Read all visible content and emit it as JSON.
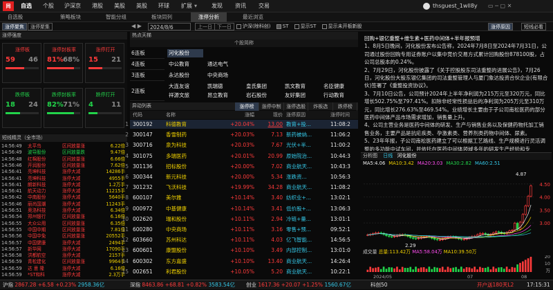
{
  "app": {
    "logo": "同花顺",
    "window_user": "thsguest_1wll8y",
    "time": "17:15:31"
  },
  "menu": [
    "自选",
    "个股",
    "沪深京",
    "港股",
    "美股",
    "英股",
    "环球",
    "扩展",
    "发现",
    "资讯",
    "交易"
  ],
  "menu_more": "▾",
  "sub_tabs": [
    "自选股",
    "策略板块",
    "智能分组",
    "板块同列",
    "涨停分析",
    "最近浏览"
  ],
  "toolbar": {
    "label_limit": "涨停聚焦",
    "label_top": "涨停聚集",
    "date": "2024/8/6",
    "prev": "上一日",
    "next": "下一日",
    "opt1": "沪深(除科创)",
    "opt2": "ST",
    "opt3": "显示ST",
    "opt4": "显示未开板新股",
    "btn_reason": "涨停原因",
    "btn_summary": "短线必看"
  },
  "left": {
    "header": "涨停强度",
    "stats": [
      {
        "title": "涨停板",
        "a": "59",
        "b": "46",
        "ratio": 0.56
      },
      {
        "title": "涨停封板率",
        "a": "81%",
        "b": "68%",
        "ratio": 0.81
      },
      {
        "title": "涨停打开",
        "a": "15",
        "b": "21",
        "ratio": 0.42
      },
      {
        "title": "跌停板",
        "a": "18",
        "b": "24",
        "ratio": 0.43
      },
      {
        "title": "跌停封板率",
        "a": "82%",
        "b": "71%",
        "ratio": 0.82
      },
      {
        "title": "跌停打开",
        "a": "4",
        "b": "11",
        "ratio": 0.27
      }
    ],
    "flow_header": "短线精灵（全市场）",
    "flow": [
      [
        "14:56:49",
        "太平鸟",
        "区间放量涨",
        "6.22倍"
      ],
      [
        "14:56:49",
        "波导股份",
        "区间放量跌",
        "9.47倍"
      ],
      [
        "14:56:48",
        "红棉股份",
        "区间放量涨",
        "6.66倍"
      ],
      [
        "14:56:46",
        "开润股份",
        "区间放量涨",
        "7.62倍"
      ],
      [
        "14:56:41",
        "亮坤科技",
        "涨停大减",
        "14286手"
      ],
      [
        "14:56:41",
        "亮坤科技",
        "涨停大减",
        "4955手"
      ],
      [
        "14:56:41",
        "朗新科技",
        "涨停大减",
        "1.2万手"
      ],
      [
        "14:56:41",
        "航天动力",
        "涨停大减",
        "11215手"
      ],
      [
        "14:56:42",
        "中南股份",
        "涨停大减",
        "5640手"
      ],
      [
        "14:56:46",
        "丽尚国潮",
        "涨停大减",
        "11243手"
      ],
      [
        "14:56:51",
        "奥洛科技",
        "涨停大减",
        "6.34倍"
      ],
      [
        "14:56:54",
        "郑州银行",
        "区间放量涨",
        "6.16倍"
      ],
      [
        "14:56:55",
        "大众公用",
        "区间放量涨",
        "6.35倍"
      ],
      [
        "14:56:55",
        "中国中期",
        "区间放量涨",
        "7.81倍"
      ],
      [
        "14:56:56",
        "中国中免",
        "区间放量涨",
        "20552手"
      ],
      [
        "14:56:57",
        "中国健康",
        "涨停大减",
        "2494手"
      ],
      [
        "14:56:57",
        "新华网",
        "涨停大减",
        "17090手"
      ],
      [
        "14:56:58",
        "洪都航空",
        "涨停大减",
        "2157手"
      ],
      [
        "14:56:59",
        "青松建化",
        "区间放量涨",
        "9964手"
      ],
      [
        "14:56:59",
        "达 意 隆",
        "涨停大减",
        "6.16倍"
      ],
      [
        "14:56:59",
        "*ST和科",
        "涨停大减",
        "2.3万手"
      ]
    ]
  },
  "heaven": {
    "header": "热点天梯",
    "col": "个股简称",
    "levels": [
      {
        "label": "6连板",
        "stocks": [
          "河化股份"
        ]
      },
      {
        "label": "4连板",
        "stocks": [
          "中公教育",
          "通达电气"
        ]
      },
      {
        "label": "3连板",
        "stocks": [
          "永达股份",
          "中央商场"
        ]
      },
      {
        "label": "2连板",
        "stocks": [
          "大连友谊",
          "凯瑞德",
          "皇氏集团",
          "凯文教育",
          "名臣健康",
          "祥源文旅",
          "昂立教育",
          "岩石股份",
          "友好集团",
          "行动教育"
        ]
      }
    ]
  },
  "list": {
    "header": "异动列表",
    "tabs": [
      "涨停榜",
      "涨停中制",
      "涨停选股",
      "炸板选",
      "跌停榜"
    ],
    "cols": [
      "代码",
      "名称",
      "涨幅",
      "现价",
      "涨停原因",
      "涨停时间"
    ],
    "rows": [
      [
        "300192",
        "科德教育",
        "+20.04%",
        "13.00",
        "教育+投...",
        "11:08:2"
      ],
      [
        "300147",
        "香雪制药",
        "+20.03%",
        "7.13",
        "新药被纳...",
        "11:06:2"
      ],
      [
        "300716",
        "泉为科技",
        "+20.03%",
        "7.67",
        "光伏+半...",
        "11:00:2"
      ],
      [
        "301075",
        "多瑞医药",
        "+20.01%",
        "20.99",
        "原始院治...",
        "10:44:3"
      ],
      [
        "301136",
        "招标股份",
        "+20.00%",
        "7.02",
        "商业航天...",
        "10:43:3"
      ],
      [
        "300344",
        "新元科技",
        "+20.00%",
        "5.34",
        "涨跌资...",
        "10:56:3"
      ],
      [
        "301232",
        "飞沃科技",
        "+19.99%",
        "34.28",
        "商业航天...",
        "11:08:2"
      ],
      [
        "600107",
        "美尔雅",
        "+10.14%",
        "3.40",
        "纺织业+...",
        "13:02:1"
      ],
      [
        "000972",
        "中基健康",
        "+10.14%",
        "3.41",
        "低价股+...",
        "13:06:3"
      ],
      [
        "002620",
        "瑞和股份",
        "+10.11%",
        "2.94",
        "冷链+量...",
        "13:01:1"
      ],
      [
        "600280",
        "中央商场",
        "+10.11%",
        "3.16",
        "零售+预...",
        "09:52:1"
      ],
      [
        "603660",
        "苏州科达",
        "+10.11%",
        "4.03",
        "亿飞智能...",
        "14:56:5"
      ],
      [
        "600601",
        "康盟股份",
        "+10.10%",
        "3.49",
        "内部控制...",
        "13:01:0"
      ],
      [
        "600302",
        "东方嘉盛",
        "+10.10%",
        "13.40",
        "商业航天...",
        "14:26:4"
      ],
      [
        "002651",
        "利君股份",
        "+10.05%",
        "5.20",
        "商业航天...",
        "10:22:1"
      ]
    ]
  },
  "news": {
    "title": "回购+银亿重整+维生素+医药中间体+半年报预增",
    "paras": [
      "1、8月5日晚间，河化股份发布公告称，2024年7月8日至2024年7月31日，公司通过股份回购专用证券账户以集中竞价交易方式累计回购股份878100股，占公司总股本的0.24%。",
      "2、7月29日，河化股份披露了《关于控股股东司法重整的进展公告》，7月26日，河化股份大股东银亿集团的司法重整管理人与厦门象达投资合伙企业(有限合伙)签署了《重整投资协议》。",
      "3、7月10日公告，公司预计2024年上半年净利润为215万元至320万元，同比增长502.75%至797.41%。扣除非经常性损益后的净利润为205万元至310万元，同比增长276.63%至469.54%。业绩增长主要由于子公司南松医药的部分医药中间体产品市场需求增加，销售量上升。",
      "4、公司主营业务是医药中间体的研发、生产与销售业务以及保健药物托加工销售业务，主要产品是抗疟疾类、孕激素类、营养剂类药物中间体、尿素。",
      "5、23年年报，子公司南松医药建立了可以根据工艺路线、生产规模进行灵活调整的多功能中试车间，并依托在医药中间体领域多年的研发生产经验和专"
    ]
  },
  "kline": {
    "tabs": [
      "分析图",
      "日线",
      "河化股份"
    ],
    "ma": [
      [
        "MA5:4.06",
        "#f0f0f0"
      ],
      [
        "MA10:3.42",
        "#f0d000"
      ],
      [
        "MA20:3.03",
        "#ff4df0"
      ],
      [
        "MA30:2.82",
        "#22d34a"
      ],
      [
        "MA60:2.51",
        "#35c8e8"
      ]
    ],
    "y_ticks": [
      "4.50",
      "4.00",
      "3.50",
      "3.00"
    ],
    "high": "4.87",
    "low": "2.29",
    "vol_label": "成交量",
    "vol_total": "总量:113.42万",
    "vol_ma5": "MA5:58.04万",
    "vol_ma10": "MA10:39.50万",
    "vol_ticks": [
      "20",
      "10",
      "万"
    ],
    "dates": [
      "2024/05",
      "07",
      "08"
    ]
  },
  "status": {
    "items": [
      {
        "name": "沪指",
        "val": "2867.28",
        "chg": "+6.58",
        "pct": "+0.23%",
        "amt": "2958.36亿"
      },
      {
        "name": "深指",
        "val": "8463.86",
        "chg": "+68.81",
        "pct": "+0.82%",
        "amt": "3583.54亿"
      },
      {
        "name": "创业",
        "val": "1617.36",
        "chg": "+20.07",
        "pct": "+1.25%",
        "amt": "1560.67亿"
      }
    ],
    "extra": "科创50",
    "right": "开户送180天L2"
  },
  "colors": {
    "red": "#ff3b3b",
    "green": "#22d34a",
    "accent": "#3a3a3a"
  }
}
